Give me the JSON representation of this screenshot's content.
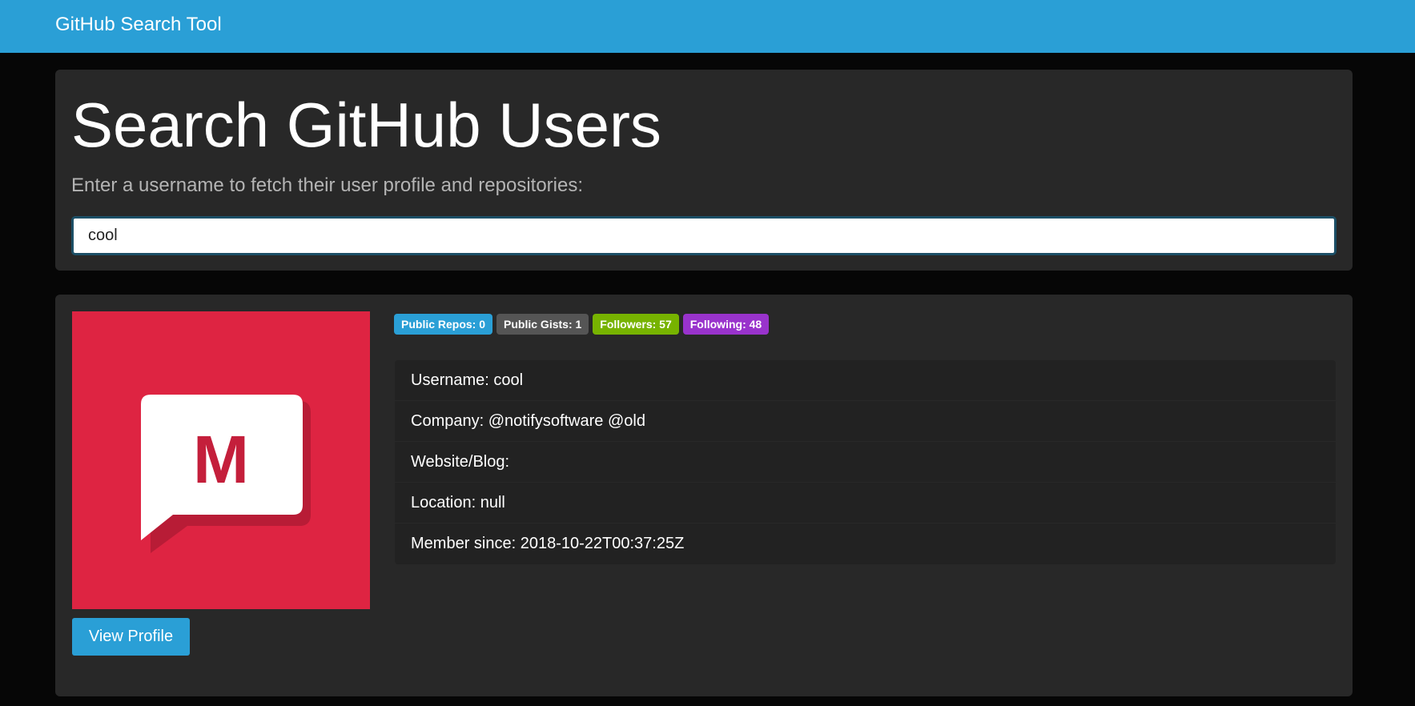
{
  "navbar": {
    "brand": "GitHub Search Tool"
  },
  "search": {
    "title": "Search GitHub Users",
    "lead": "Enter a username to fetch their user profile and repositories:",
    "value": "cool"
  },
  "profile": {
    "avatar_letter": "M",
    "view_profile_label": "View Profile",
    "badges": {
      "public_repos": "Public Repos: 0",
      "public_gists": "Public Gists: 1",
      "followers": "Followers: 57",
      "following": "Following: 48"
    },
    "info": {
      "username": "Username: cool",
      "company": "Company: @notifysoftware @old",
      "website": "Website/Blog:",
      "location": "Location: null",
      "member_since": "Member since: 2018-10-22T00:37:25Z"
    }
  },
  "colors": {
    "primary": "#2a9fd6",
    "secondary": "#555555",
    "success": "#77b300",
    "info": "#9933cc",
    "avatar_bg": "#de2442"
  }
}
